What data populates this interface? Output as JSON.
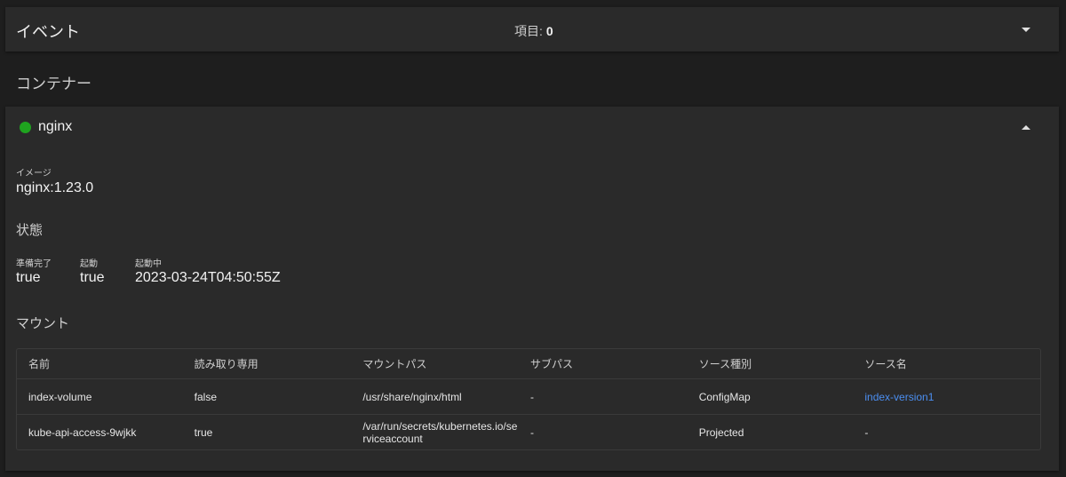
{
  "events": {
    "title": "イベント",
    "count_label": "項目:",
    "count_value": "0"
  },
  "containers": {
    "heading": "コンテナー"
  },
  "container": {
    "name": "nginx",
    "status_color": "#1fa31f",
    "image_label": "イメージ",
    "image_value": "nginx:1.23.0",
    "state_title": "状態",
    "state": {
      "ready_label": "準備完了",
      "ready_value": "true",
      "started_label": "起動",
      "started_value": "true",
      "running_label": "起動中",
      "running_value": "2023-03-24T04:50:55Z"
    },
    "mounts_title": "マウント",
    "mounts": {
      "columns": [
        "名前",
        "読み取り専用",
        "マウントパス",
        "サブパス",
        "ソース種別",
        "ソース名"
      ],
      "rows": [
        {
          "name": "index-volume",
          "read_only": "false",
          "mount_path": "/usr/share/nginx/html",
          "sub_path": "-",
          "source_type": "ConfigMap",
          "source_name": "index-version1"
        },
        {
          "name": "kube-api-access-9wjkk",
          "read_only": "true",
          "mount_path": "/var/run/secrets/kubernetes.io/serviceaccount",
          "sub_path": "-",
          "source_type": "Projected",
          "source_name": "-"
        }
      ]
    }
  },
  "colors": {
    "background": "#1e1e1e",
    "card": "#2a2a2a",
    "link": "#4b8ef0"
  }
}
